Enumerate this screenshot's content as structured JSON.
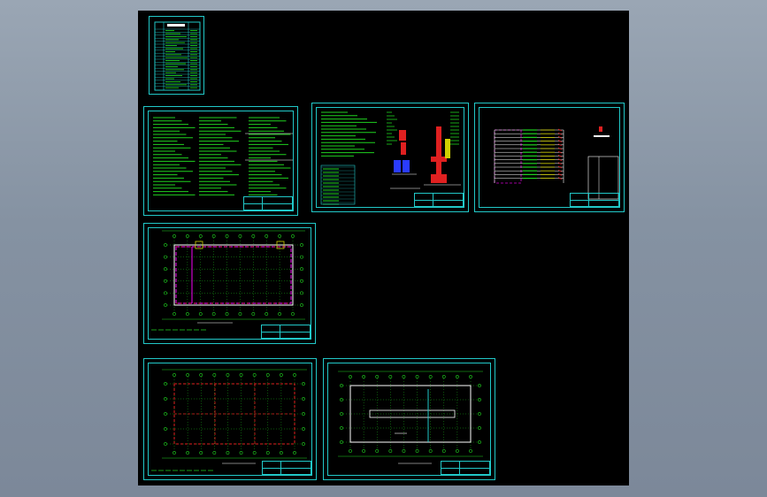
{
  "app": {
    "name": "",
    "background_color": "#000000",
    "frame_color": "#21c8c8",
    "text_color": "#1fd11f",
    "highlight_color": "#ff2a2a",
    "accent_color": "#d000d0"
  },
  "sheets": [
    {
      "id": "drawing-index",
      "kind": "table"
    },
    {
      "id": "design-notes",
      "kind": "text"
    },
    {
      "id": "details",
      "kind": "details"
    },
    {
      "id": "system-diagram",
      "kind": "schematic"
    },
    {
      "id": "floor-plan-1",
      "kind": "plan"
    },
    {
      "id": "floor-plan-2",
      "kind": "plan"
    },
    {
      "id": "floor-plan-3",
      "kind": "plan"
    }
  ]
}
